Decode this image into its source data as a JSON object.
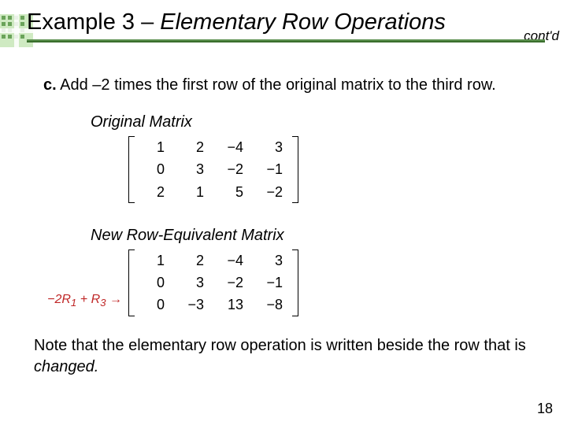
{
  "title": {
    "example": "Example 3",
    "dash": " – ",
    "topic": "Elementary Row Operations",
    "contd": "cont'd"
  },
  "partC": {
    "label": "c.",
    "text": " Add –2 times the first row of the original matrix to the third row."
  },
  "originalLabel": "Original Matrix",
  "newLabel": "New Row-Equivalent Matrix",
  "originalMatrix": {
    "r1c1": "1",
    "r1c2": "2",
    "r1c3": "−4",
    "r1c4": "3",
    "r2c1": "0",
    "r2c2": "3",
    "r2c3": "−2",
    "r2c4": "−1",
    "r3c1": "2",
    "r3c2": "1",
    "r3c3": "5",
    "r3c4": "−2"
  },
  "newMatrix": {
    "r1c1": "1",
    "r1c2": "2",
    "r1c3": "−4",
    "r1c4": "3",
    "r2c1": "0",
    "r2c2": "3",
    "r2c3": "−2",
    "r2c4": "−1",
    "r3c1": "0",
    "r3c2": "−3",
    "r3c3": "13",
    "r3c4": "−8"
  },
  "rowOp": {
    "neg2": "−2",
    "R1": "R",
    "R1sub": "1",
    "plus": " + ",
    "R3": "R",
    "R3sub": "3",
    "arrow": " →"
  },
  "noteA": "Note that the elementary row operation is written beside the row that is ",
  "noteB": "changed.",
  "pageNum": "18",
  "chart_data": {
    "type": "table",
    "title": "Elementary Row Operation: −2R1 + R3 → R3",
    "original_matrix": [
      [
        1,
        2,
        -4,
        3
      ],
      [
        0,
        3,
        -2,
        -1
      ],
      [
        2,
        1,
        5,
        -2
      ]
    ],
    "new_matrix": [
      [
        1,
        2,
        -4,
        3
      ],
      [
        0,
        3,
        -2,
        -1
      ],
      [
        0,
        -3,
        13,
        -8
      ]
    ]
  }
}
